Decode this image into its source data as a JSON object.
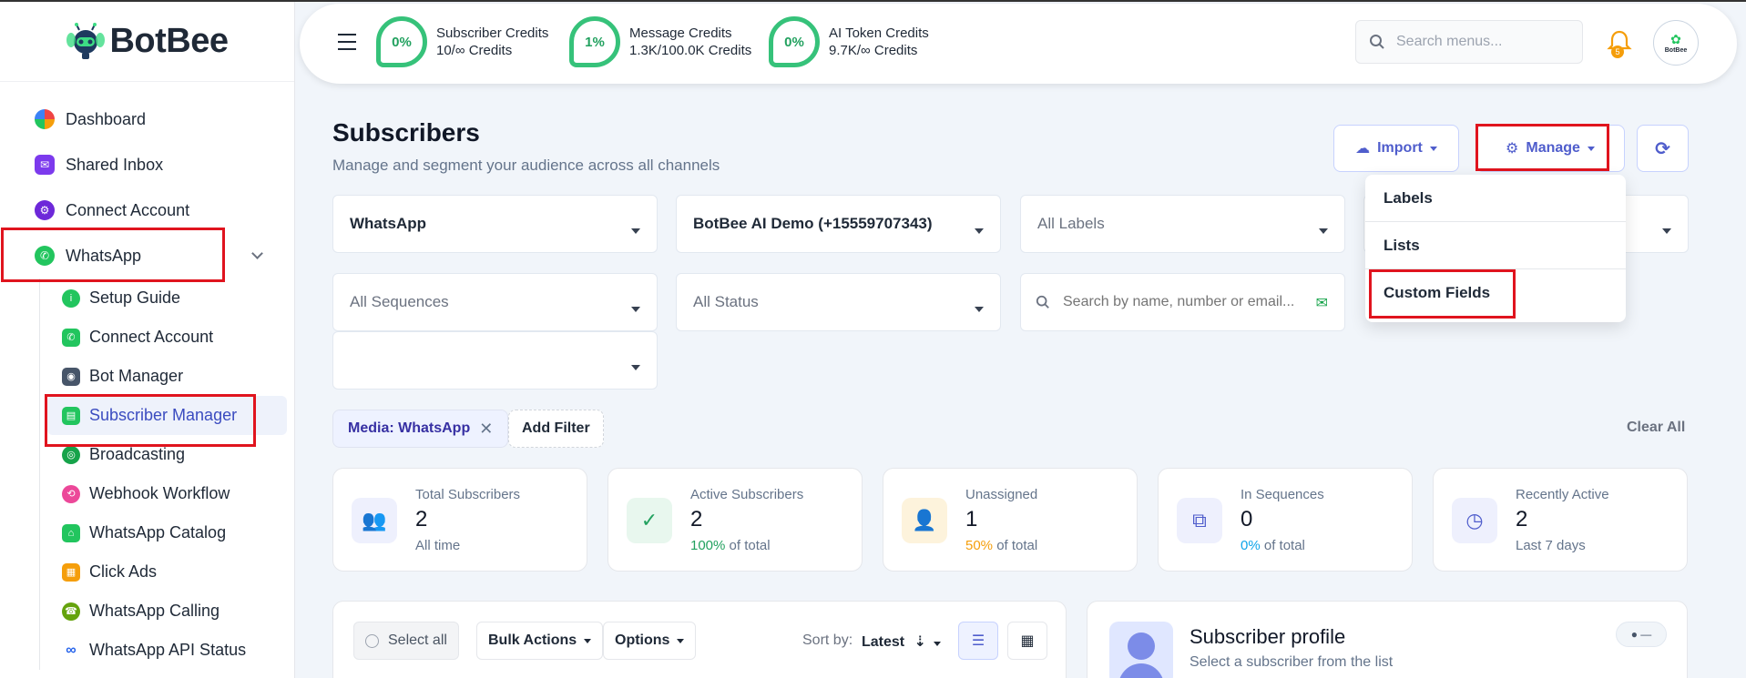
{
  "brand": {
    "name": "BotBee"
  },
  "sidebar": {
    "items": [
      {
        "label": "Dashboard",
        "icon": "dashboard-icon"
      },
      {
        "label": "Shared Inbox",
        "icon": "shared-inbox-icon"
      },
      {
        "label": "Connect Account",
        "icon": "connect-account-icon"
      },
      {
        "label": "WhatsApp",
        "icon": "whatsapp-icon"
      }
    ],
    "sub_items": [
      {
        "label": "Setup Guide",
        "icon": "info-icon"
      },
      {
        "label": "Connect Account",
        "icon": "whatsapp-icon"
      },
      {
        "label": "Bot Manager",
        "icon": "bot-icon"
      },
      {
        "label": "Subscriber Manager",
        "icon": "subscriber-icon"
      },
      {
        "label": "Broadcasting",
        "icon": "broadcast-icon"
      },
      {
        "label": "Webhook Workflow",
        "icon": "webhook-icon"
      },
      {
        "label": "WhatsApp Catalog",
        "icon": "bag-icon"
      },
      {
        "label": "Click Ads",
        "icon": "ads-icon"
      },
      {
        "label": "WhatsApp Calling",
        "icon": "phone-icon"
      },
      {
        "label": "WhatsApp API Status",
        "icon": "meta-icon"
      }
    ]
  },
  "topbar": {
    "credits": [
      {
        "percent": "0%",
        "title": "Subscriber Credits",
        "detail": "10/∞ Credits"
      },
      {
        "percent": "1%",
        "title": "Message Credits",
        "detail": "1.3K/100.0K Credits"
      },
      {
        "percent": "0%",
        "title": "AI Token Credits",
        "detail": "9.7K/∞ Credits"
      }
    ],
    "search_placeholder": "Search menus...",
    "notification_count": "5",
    "avatar_text": "BotBee"
  },
  "page": {
    "title": "Subscribers",
    "subtitle": "Manage and segment your audience across all channels",
    "import_label": "Import",
    "manage_label": "Manage"
  },
  "manage_menu": [
    "Labels",
    "Lists",
    "Custom Fields"
  ],
  "filters": {
    "channel": "WhatsApp",
    "account": "BotBee AI Demo (+15559707343)",
    "labels": "All Labels",
    "sequences": "All Sequences",
    "status": "All Status",
    "search_placeholder": "Search by name, number or email...",
    "extra": ""
  },
  "chips": {
    "active_filter": "Media: WhatsApp",
    "add_filter": "Add Filter",
    "clear_all": "Clear All"
  },
  "stats": [
    {
      "label": "Total Subscribers",
      "value": "2",
      "pct": "",
      "foot": "All time",
      "color": "#5b6bd8",
      "bg": "#eef0fd"
    },
    {
      "label": "Active Subscribers",
      "value": "2",
      "pct": "100%",
      "foot": " of total",
      "color": "#22a15f",
      "bg": "#e8f7ee"
    },
    {
      "label": "Unassigned",
      "value": "1",
      "pct": "50%",
      "foot": " of total",
      "color": "#f59e0b",
      "bg": "#fdf3dc"
    },
    {
      "label": "In Sequences",
      "value": "0",
      "pct": "0%",
      "foot": " of total",
      "color": "#0ea5e9",
      "bg": "#eef0fd"
    },
    {
      "label": "Recently Active",
      "value": "2",
      "pct": "",
      "foot": "Last 7 days",
      "color": "#4f5dcc",
      "bg": "#eef0fd"
    }
  ],
  "list": {
    "select_all": "Select all",
    "bulk_actions": "Bulk Actions",
    "options": "Options",
    "sort_by": "Sort by:",
    "sort_value": "Latest"
  },
  "profile": {
    "title": "Subscriber profile",
    "subtitle": "Select a subscriber from the list"
  }
}
